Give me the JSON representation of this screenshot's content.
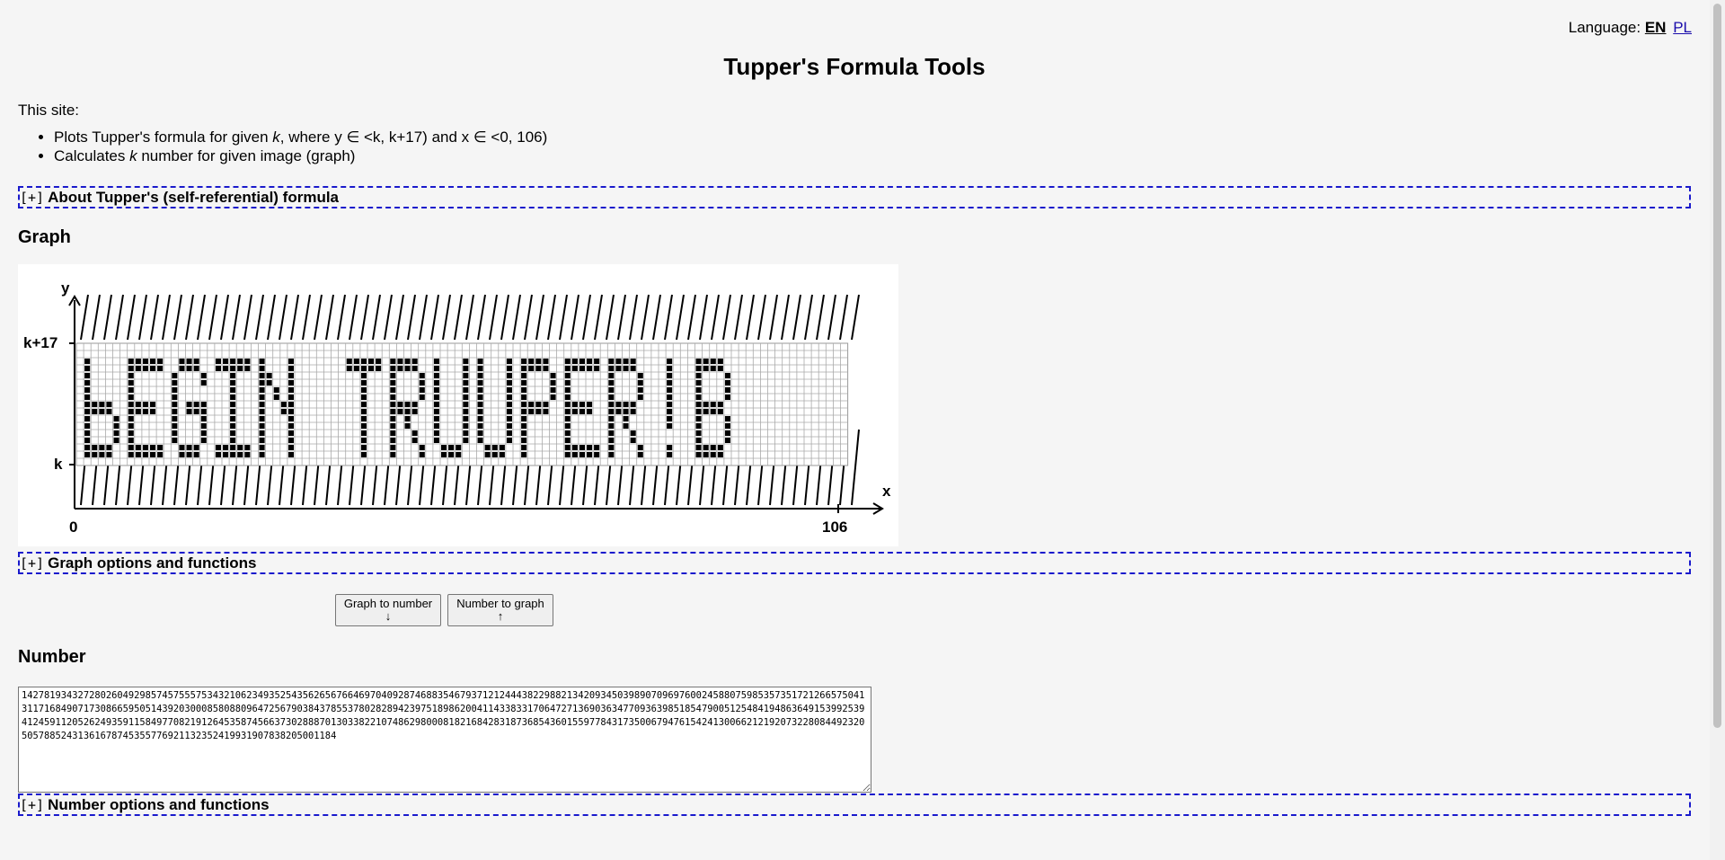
{
  "language": {
    "label": "Language:",
    "options": [
      "EN",
      "PL"
    ],
    "active": "EN"
  },
  "title": "Tupper's Formula Tools",
  "intro": "This site:",
  "features": {
    "f1_pre": "Plots Tupper's formula for given ",
    "f1_k": "k",
    "f1_post": ", where y ∈ <k, k+17) and x ∈ <0, 106)",
    "f2_pre": "Calculates ",
    "f2_k": "k",
    "f2_post": " number for given image (graph)"
  },
  "sections": {
    "about": "About Tupper's (self-referential) formula",
    "graph_options": "Graph options and functions",
    "number_options": "Number options and functions",
    "toggle": "[+]"
  },
  "graph": {
    "heading": "Graph",
    "y_axis": "y",
    "x_axis": "x",
    "label_k17": "k+17",
    "label_k": "k",
    "label_0": "0",
    "label_106": "106",
    "bitmap_text": "bEGIN TRUUPER!B"
  },
  "buttons": {
    "graph_to_number": "Graph to number",
    "graph_to_number_arrow": "↓",
    "number_to_graph": "Number to graph",
    "number_to_graph_arrow": "↑"
  },
  "number": {
    "heading": "Number",
    "value": "14278193432728026049298574575557534321062349352543562656766469704092874688354679371212444382298821342093450398907096976002458807598535735172126657504131171684907173086659505143920300085808809647256790384378553780282894239751898620041143383317064727136903634770936398518547900512548419486364915399253941245911205262493591158497708219126453587456637302888701303382210748629800081821684283187368543601559778431735006794761542413006621219207322808449232050578852431361678745355776921132352419931907838205001184"
  }
}
